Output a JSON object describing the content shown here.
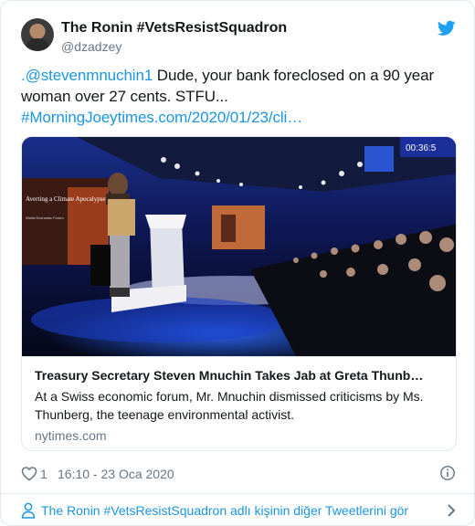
{
  "author": {
    "display_name": "The Ronin #VetsResistSquadron",
    "handle": "@dzadzey"
  },
  "tweet": {
    "mention": ".@stevenmnuchin1",
    "text": " Dude, your bank foreclosed on a 90 year woman over 27 cents. STFU... ",
    "link": "#MorningJoeytimes.com/2020/01/23/cli…"
  },
  "card": {
    "title": "Treasury Secretary Steven Mnuchin Takes Jab at Greta Thunb…",
    "description": "At a Swiss economic forum, Mr. Mnuchin dismissed criticisms by Ms. Thunberg, the teenage environmental activist.",
    "domain": "nytimes.com",
    "image": {
      "screen_text_title": "Averting a Climate Apocalypse",
      "screen_text_sub": "World Economic Forum",
      "screen_timer": "00:36:5"
    }
  },
  "meta": {
    "like_count": "1",
    "timestamp": "16:10 - 23 Oca 2020"
  },
  "footer": {
    "more_tweets": "The Ronin #VetsResistSquadron adlı kişinin diğer Tweetlerini gör"
  },
  "colors": {
    "link_blue": "#1b95e0",
    "twitter_blue": "#1da1f2",
    "secondary_text": "#657786"
  },
  "icons": [
    "twitter-bird-icon",
    "heart-icon",
    "info-icon",
    "person-icon",
    "chevron-right-icon"
  ]
}
